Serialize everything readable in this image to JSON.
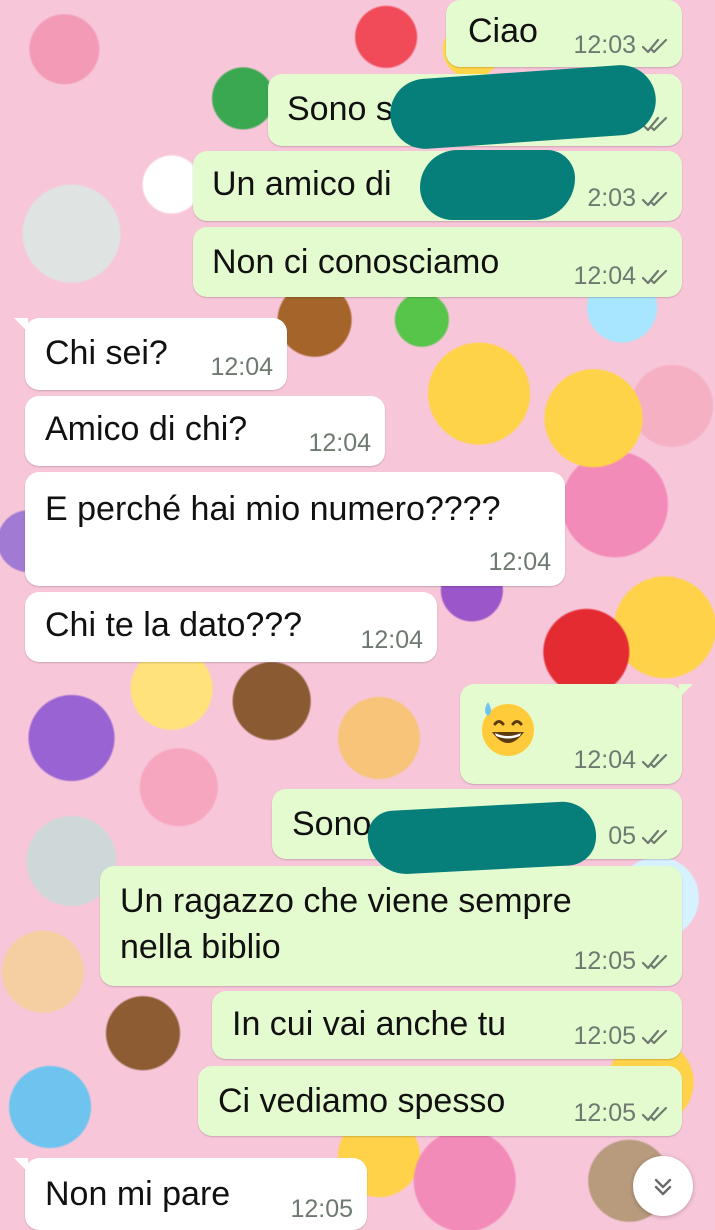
{
  "messages": [
    {
      "id": "m1",
      "direction": "out",
      "text": "Ciao",
      "time": "12:03",
      "status": "read"
    },
    {
      "id": "m2",
      "direction": "out",
      "text": "Sono s",
      "time": "",
      "status": "read",
      "redacted": true
    },
    {
      "id": "m3",
      "direction": "out",
      "text": "Un amico di",
      "time": "2:03",
      "status": "read",
      "redacted": true
    },
    {
      "id": "m4",
      "direction": "out",
      "text": "Non ci conosciamo",
      "time": "12:04",
      "status": "read"
    },
    {
      "id": "m5",
      "direction": "in",
      "text": "Chi sei?",
      "time": "12:04"
    },
    {
      "id": "m6",
      "direction": "in",
      "text": "Amico di chi?",
      "time": "12:04"
    },
    {
      "id": "m7",
      "direction": "in",
      "text": "E perché hai mio numero????",
      "time": "12:04"
    },
    {
      "id": "m8",
      "direction": "in",
      "text": "Chi te la dato???",
      "time": "12:04"
    },
    {
      "id": "m9",
      "direction": "out",
      "text": "😅",
      "time": "12:04",
      "status": "read"
    },
    {
      "id": "m10",
      "direction": "out",
      "text": "Sono",
      "time": "05",
      "status": "read",
      "redacted": true
    },
    {
      "id": "m11",
      "direction": "out",
      "text": "Un ragazzo che viene sempre nella biblio",
      "time": "12:05",
      "status": "read"
    },
    {
      "id": "m12",
      "direction": "out",
      "text": "In cui vai anche tu",
      "time": "12:05",
      "status": "read"
    },
    {
      "id": "m13",
      "direction": "out",
      "text": "Ci vediamo spesso",
      "time": "12:05",
      "status": "read"
    },
    {
      "id": "m14",
      "direction": "in",
      "text": "Non mi pare",
      "time": "12:05"
    }
  ],
  "colors": {
    "outgoing_bubble": "#e4fbd0",
    "incoming_bubble": "#ffffff",
    "read_ticks": "#6e7a70",
    "redaction": "#067f7a"
  },
  "wallpaper": {
    "style": "emoji-collage"
  },
  "controls": {
    "scroll_down_icon": "chevron-double-down-icon"
  }
}
